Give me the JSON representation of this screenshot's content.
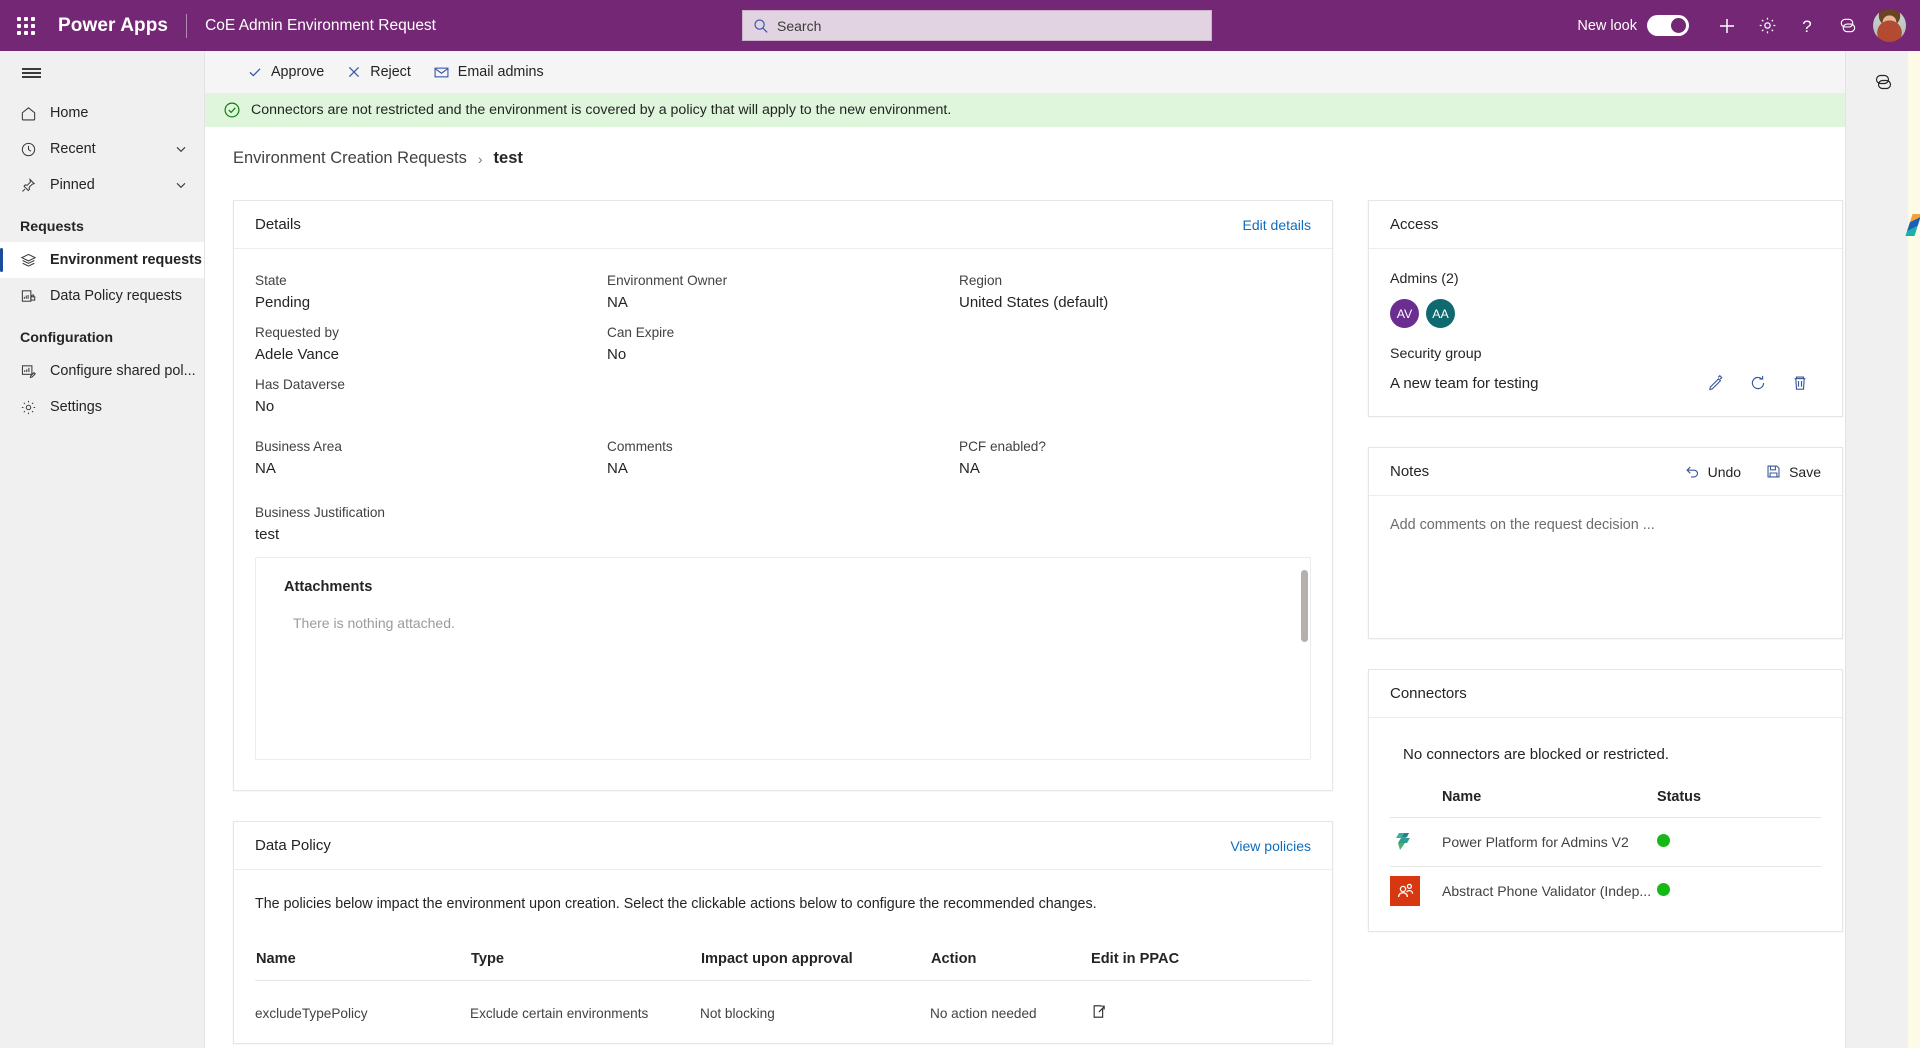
{
  "suite": {
    "waffle": "app-launcher",
    "brand": "Power Apps",
    "app_name": "CoE Admin Environment Request",
    "search_placeholder": "Search",
    "new_look_label": "New look",
    "new_look_on": true,
    "icons": [
      "plus-icon",
      "gear-icon",
      "help-icon",
      "feedback-icon",
      "avatar"
    ]
  },
  "sidebar": {
    "items": [
      {
        "label": "Home",
        "icon": "home-icon",
        "chevron": false,
        "selected": false
      },
      {
        "label": "Recent",
        "icon": "clock-icon",
        "chevron": true,
        "selected": false
      },
      {
        "label": "Pinned",
        "icon": "pin-icon",
        "chevron": true,
        "selected": false
      }
    ],
    "groups": [
      {
        "title": "Requests",
        "items": [
          {
            "label": "Environment requests",
            "icon": "layers-icon",
            "selected": true
          },
          {
            "label": "Data Policy requests",
            "icon": "policy-chart-icon",
            "selected": false
          }
        ]
      },
      {
        "title": "Configuration",
        "items": [
          {
            "label": "Configure shared pol...",
            "icon": "edit-chart-icon",
            "selected": false
          },
          {
            "label": "Settings",
            "icon": "gear-icon",
            "selected": false
          }
        ]
      }
    ]
  },
  "command_bar": {
    "approve": "Approve",
    "reject": "Reject",
    "email_admins": "Email admins"
  },
  "notification": {
    "message": "Connectors are not restricted and the environment is covered by a policy that will apply to the new environment.",
    "icon": "check-circle-icon",
    "background": "#dff6dd"
  },
  "breadcrumb": {
    "root": "Environment Creation Requests",
    "separator": "›",
    "current": "test"
  },
  "details": {
    "title": "Details",
    "edit_action": "Edit details",
    "rows": [
      [
        {
          "label": "State",
          "value": "Pending"
        },
        {
          "label": "Environment Owner",
          "value": "NA"
        },
        {
          "label": "Region",
          "value": "United States (default)"
        }
      ],
      [
        {
          "label": "Requested by",
          "value": "Adele Vance"
        },
        {
          "label": "Can Expire",
          "value": "No"
        },
        {
          "label": "",
          "value": ""
        }
      ],
      [
        {
          "label": "Has Dataverse",
          "value": "No"
        },
        {
          "label": "",
          "value": ""
        },
        {
          "label": "",
          "value": ""
        }
      ],
      [
        {
          "label": "Business Area",
          "value": "NA"
        },
        {
          "label": "Comments",
          "value": "NA"
        },
        {
          "label": "PCF enabled?",
          "value": "NA"
        }
      ],
      [
        {
          "label": "Business Justification",
          "value": "test"
        }
      ]
    ],
    "attachments": {
      "title": "Attachments",
      "empty_text": "There is nothing attached."
    }
  },
  "data_policy": {
    "title": "Data Policy",
    "view_action": "View policies",
    "description": "The policies below impact the environment upon creation. Select the clickable actions below to configure the recommended changes.",
    "columns": [
      "Name",
      "Type",
      "Impact upon approval",
      "Action",
      "Edit in PPAC"
    ],
    "rows": [
      {
        "name": "excludeTypePolicy",
        "type": "Exclude certain environments",
        "impact": "Not blocking",
        "action": "No action needed",
        "ppac_icon": "open-in-new-icon"
      }
    ]
  },
  "access": {
    "title": "Access",
    "admins_label": "Admins (2)",
    "admins": [
      {
        "initials": "AV",
        "color": "#6b2d90"
      },
      {
        "initials": "AA",
        "color": "#0f6a70"
      }
    ],
    "security_group_label": "Security group",
    "security_group_value": "A new team for testing",
    "actions": [
      "edit-pencil-icon",
      "refresh-icon",
      "delete-trash-icon"
    ]
  },
  "notes": {
    "title": "Notes",
    "undo_label": "Undo",
    "save_label": "Save",
    "placeholder": "Add comments on the request decision ...",
    "value": ""
  },
  "connectors": {
    "title": "Connectors",
    "message": "No connectors are blocked or restricted.",
    "columns": [
      "Name",
      "Status"
    ],
    "rows": [
      {
        "name": "Power Platform for Admins V2",
        "status_color": "#16b816",
        "logo": "power-platform-logo"
      },
      {
        "name": "Abstract Phone Validator (Indep...",
        "status_color": "#16b816",
        "logo": "abstract-phone-validator-logo"
      }
    ]
  },
  "right_rail": {
    "icon": "copilot-icon"
  },
  "theme": {
    "suite_bar": "#742774",
    "accent_link": "#0f6cbd",
    "selected_indicator": "#1b4b9b",
    "success": "#16b816"
  }
}
